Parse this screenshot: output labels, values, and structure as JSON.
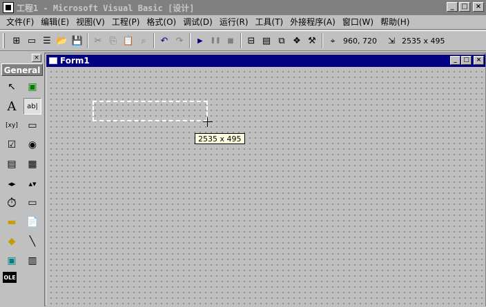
{
  "window": {
    "title": "工程1 - Microsoft Visual Basic [设计]",
    "min": "_",
    "max": "□",
    "close": "×"
  },
  "menu": [
    "文件(F)",
    "编辑(E)",
    "视图(V)",
    "工程(P)",
    "格式(O)",
    "调试(D)",
    "运行(R)",
    "工具(T)",
    "外接程序(A)",
    "窗口(W)",
    "帮助(H)"
  ],
  "toolbar": {
    "add_project": "⊞",
    "add_form": "▭",
    "menu_editor": "☰",
    "open": "📂",
    "save": "💾",
    "cut": "✂",
    "copy": "⎘",
    "paste": "📋",
    "find": "⌕",
    "undo": "↶",
    "redo": "↷",
    "start": "▶",
    "pause": "❚❚",
    "stop": "■",
    "project_explorer": "⊟",
    "properties": "▤",
    "form_layout": "⧉",
    "object_browser": "❖",
    "toolbox": "⚒",
    "position_value": "960, 720",
    "size_value": "2535 x 495"
  },
  "toolbox": {
    "header": "General",
    "close": "×",
    "tools": [
      "↖",
      "▣",
      "A",
      "ab|",
      "[xy]",
      "▭",
      "☑",
      "◉",
      "▤",
      "▦",
      "◂▸",
      "▴▾",
      "⏱",
      "▭",
      "▬",
      "📄",
      "◆",
      "╲",
      "▣",
      "▥",
      "OLE"
    ]
  },
  "form": {
    "title": "Form1",
    "min": "_",
    "max": "□",
    "close": "×"
  },
  "tooltip": "2535 x 495"
}
